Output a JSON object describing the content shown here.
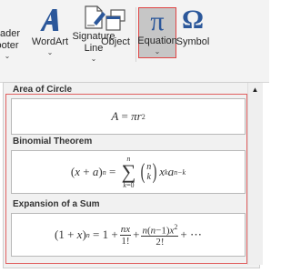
{
  "ribbon": {
    "buttons": [
      {
        "id": "header-footer",
        "label_line1": "eader",
        "label_line2": "ooter",
        "has_dropdown": true
      },
      {
        "id": "wordart",
        "label_line1": "WordArt",
        "label_line2": "",
        "has_dropdown": true
      },
      {
        "id": "signature-line",
        "label_line1": "Signature",
        "label_line2": "Line",
        "has_dropdown": true
      },
      {
        "id": "object",
        "label_line1": "Object",
        "label_line2": "",
        "has_dropdown": false
      },
      {
        "id": "equation",
        "label_line1": "Equation",
        "label_line2": "",
        "has_dropdown": true,
        "active": true
      },
      {
        "id": "symbol",
        "label_line1": "Symbol",
        "label_line2": "",
        "has_dropdown": false
      }
    ]
  },
  "gallery": {
    "sections": [
      {
        "title": "Area of Circle"
      },
      {
        "title": "Binomial Theorem"
      },
      {
        "title": "Expansion of a Sum"
      }
    ]
  },
  "colors": {
    "accent_blue": "#2b579a",
    "active_bg": "#c6c6c6",
    "highlight_red": "#e04444"
  },
  "icons": {
    "wordart": "wordart-icon",
    "signature": "signature-line-icon",
    "object": "object-icon",
    "equation": "pi-icon",
    "symbol": "omega-icon",
    "scroll": "scroll-up-arrow-icon"
  }
}
